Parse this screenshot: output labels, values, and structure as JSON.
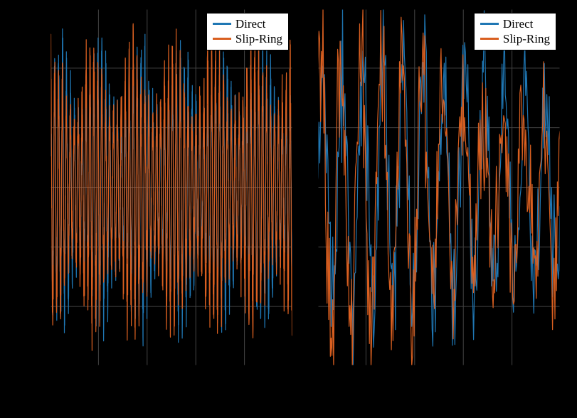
{
  "colors": {
    "direct": "#1f77b4",
    "slipring": "#d95f20",
    "grid": "#444444",
    "axis": "#000000",
    "legend_bg": "#ffffff"
  },
  "legends": {
    "left": {
      "items": [
        {
          "key": "direct",
          "label": "Direct"
        },
        {
          "key": "slipring",
          "label": "Slip-Ring"
        }
      ]
    },
    "right": {
      "items": [
        {
          "key": "direct",
          "label": "Direct"
        },
        {
          "key": "slipring",
          "label": "Slip-Ring"
        }
      ]
    }
  },
  "chart_data": [
    {
      "id": "left",
      "type": "line",
      "title": "",
      "xlabel": "",
      "ylabel": "",
      "xlim": [
        0,
        10
      ],
      "ylim": [
        -1.3,
        1.3
      ],
      "grid": true,
      "legend_position": "top-right",
      "n": 2000,
      "description": "Dense noisy time-series comparison; both series fill roughly ±1 amplitude band (data not readable from pixels)",
      "series": [
        {
          "name": "Direct",
          "color_key": "direct",
          "amplitude": 1.0,
          "freq": 62,
          "jitter": 0.05,
          "phase": 0.0
        },
        {
          "name": "Slip-Ring",
          "color_key": "slipring",
          "amplitude": 1.02,
          "freq": 62,
          "jitter": 0.06,
          "phase": 0.02
        }
      ]
    },
    {
      "id": "right",
      "type": "line",
      "title": "",
      "xlabel": "",
      "ylabel": "",
      "xlim": [
        0,
        1
      ],
      "ylim": [
        -1.2,
        1.2
      ],
      "grid": true,
      "legend_position": "top-right",
      "n": 300,
      "description": "Zoomed-in segment of the two signals; individual oscillations visible (data not readable from pixels)",
      "series": [
        {
          "name": "Direct",
          "color_key": "direct",
          "amplitude": 0.95,
          "freq": 12,
          "jitter": 0.25,
          "phase": 0.0
        },
        {
          "name": "Slip-Ring",
          "color_key": "slipring",
          "amplitude": 1.0,
          "freq": 12,
          "jitter": 0.28,
          "phase": 0.08
        }
      ]
    }
  ]
}
